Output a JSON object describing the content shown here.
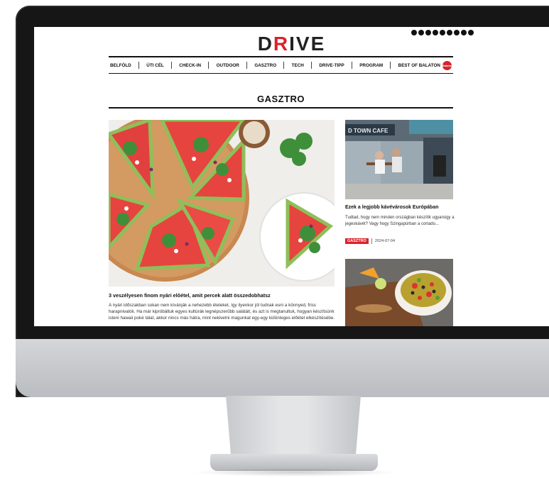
{
  "logo": {
    "part1": "D",
    "part2": "R",
    "part3": "IVE"
  },
  "social_icons": [
    "facebook-icon",
    "instagram-icon",
    "tiktok-icon",
    "youtube-icon",
    "email-icon",
    "info-icon",
    "instagram-alt-icon",
    "newsletter-icon",
    "search-icon"
  ],
  "nav": {
    "items": [
      "BELFÖLD",
      "ÚTI CÉL",
      "CHECK-IN",
      "OUTDOOR",
      "GASZTRO",
      "TECH",
      "DRIVE-TIPP",
      "PROGRAM",
      "BEST OF BALATON"
    ],
    "badge": "Balaton"
  },
  "section": {
    "title": "GASZTRO"
  },
  "main_article": {
    "title": "3 veszélyesen finom nyári előétel, amit percek alatt összedobhatsz",
    "excerpt": "A nyári időszakban sokan nem kívánják a nehezebb ételeket, így ilyenkor jól tudnak esni a könnyed, friss harapnivalók. Ha már kipróbáltuk egyes kultúrák legnépszerűbb salátáit, és azt is megtanultuk, hogyan készítsünk isteni hawaii poké tálat, akkor nincs más hátra, mint nekivetni magunkat egy-egy különleges előétel elkészítésébe."
  },
  "side_article_1": {
    "image_sign": "D TOWN CAFE",
    "title": "Ezek a legjobb kávévárosok Európában",
    "excerpt": "Tudtad, hogy nem minden országban készítik ugyanúgy a jegeskávét? Vagy hogy Szingapúrban a cortado...",
    "tag": "GASZTRO",
    "date": "2024-07-04"
  },
  "colors": {
    "accent": "#d9222a",
    "text": "#111111"
  }
}
